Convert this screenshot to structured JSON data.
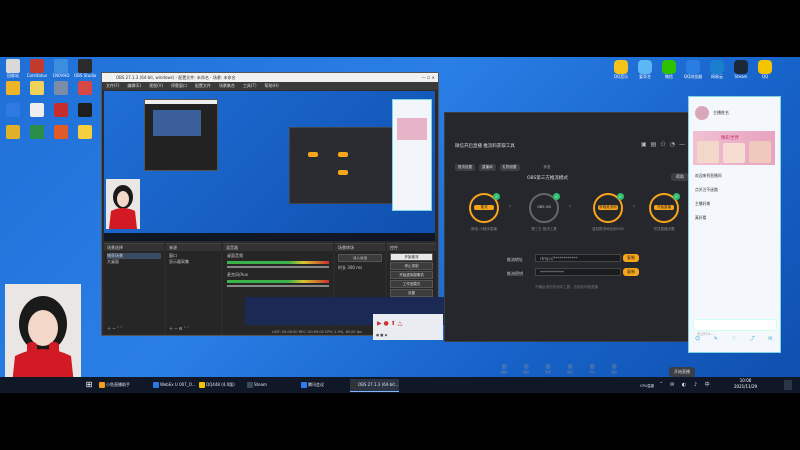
{
  "desktop": {
    "left_icons": [
      {
        "label": "回收站",
        "color": "#d9d9d9"
      },
      {
        "label": "Conlitatuv",
        "color": "#c23a2e"
      },
      {
        "label": "1N0VHD",
        "color": "#3b8de0"
      },
      {
        "label": "OBS Studio",
        "color": "#2b2b2b"
      },
      {
        "label": "",
        "color": "#f0b429"
      },
      {
        "label": "",
        "color": "#f0d45a"
      },
      {
        "label": "",
        "color": "#7a8ca6"
      },
      {
        "label": "",
        "color": "#d84646"
      },
      {
        "label": "",
        "color": "#2f7ae0"
      },
      {
        "label": "",
        "color": "#eeeeee"
      },
      {
        "label": "",
        "color": "#c82d2d"
      },
      {
        "label": "",
        "color": "#1e1e1e"
      },
      {
        "label": "",
        "color": "#e0b02a"
      },
      {
        "label": "",
        "color": "#2c8c4a"
      },
      {
        "label": "",
        "color": "#e05a2a"
      },
      {
        "label": "",
        "color": "#f4d03f"
      }
    ],
    "right_icons": [
      {
        "label": "QQ音乐",
        "color": "#f6c31a"
      },
      {
        "label": "爱奇艺",
        "color": "#5bb8f5"
      },
      {
        "label": "微信",
        "color": "#2dc100"
      },
      {
        "label": "QQ浏览器",
        "color": "#2a7de1"
      },
      {
        "label": "网易云",
        "color": "#1a7fd0"
      },
      {
        "label": "Steam",
        "color": "#1b2838"
      },
      {
        "label": "QQ",
        "color": "#f5c400"
      }
    ]
  },
  "obs": {
    "title": "OBS 27.1.3 (64-bit, windows) - 配置文件: 未命名 - 场景: 未命名",
    "menu": [
      "文件(F)",
      "编辑(E)",
      "视图(V)",
      "停靠窗口",
      "配置文件",
      "场景集合",
      "工具(T)",
      "帮助(H)"
    ],
    "docks": {
      "scenes": {
        "header": "场景选择",
        "items": [
          "捕获场景",
          "大桌面"
        ]
      },
      "sources": {
        "header": "来源",
        "items": [
          "窗口",
          "显示器采集"
        ]
      },
      "mixer": {
        "header": "混音器",
        "tracks": [
          "桌面音频",
          "麦克风/Aux"
        ]
      },
      "transitions": {
        "header": "场景转场",
        "value": "淡入淡出",
        "duration_label": "时长",
        "duration": "300 ms"
      },
      "controls": {
        "header": "控件",
        "buttons": [
          "开始推流",
          "停止录制",
          "开始虚拟摄像机",
          "工作室模式",
          "设置",
          "退出"
        ]
      }
    },
    "status": "LIVE: 00:00:00  REC: 00:00:00  CPU: 1.5%, 60.00 fps"
  },
  "tool": {
    "title": "微信开启直播 推流码获取工具",
    "tabs": [
      "推流设置",
      "直播间",
      "礼物设置"
    ],
    "status_label": "状态",
    "step_title": "OBS第三方推流模式",
    "help": "帮助",
    "steps": [
      {
        "top": "推流",
        "caption": "微信-小程序直播"
      },
      {
        "top": "OBS ON",
        "caption": "第三方 推流工具"
      },
      {
        "top": "获取推流码",
        "caption": "复制推流地址到OBS"
      },
      {
        "top": "开始直播",
        "caption": "完成直播设置"
      }
    ],
    "server_label": "推流地址",
    "server_value": "rtmp://************",
    "key_label": "推流密钥",
    "key_value": "************",
    "copy_label": "复制",
    "notice": "开播后请勿关闭本工具，否则会中断直播",
    "bottom_icons": [
      "美颜",
      "贴纸",
      "音乐",
      "连麦",
      "分享",
      "设置"
    ],
    "start_label": "开始直播"
  },
  "chat": {
    "header": "主播姓名",
    "banner": "精彩世界",
    "messages": [
      "欢迎来到直播间",
      "点关注不迷路",
      "主播好美",
      "真好看"
    ],
    "input_placeholder": "说点什么…"
  },
  "taskbar": {
    "items": [
      {
        "label": "小鱼直播助手",
        "color": "#f0a020"
      },
      {
        "label": "WebEx U 007_O...",
        "color": "#2a7ae0"
      },
      {
        "label": "QQ448 (4.0版)",
        "color": "#f5c400"
      },
      {
        "label": "Steam",
        "color": "#3a4a5e"
      },
      {
        "label": "腾讯会议",
        "color": "#2d7df0"
      },
      {
        "label": "OBS 27.1.3 (64-bit...",
        "color": "#333333"
      }
    ],
    "tray_text": "CPU温度",
    "time": "10:06",
    "date": "2021/11/29"
  }
}
